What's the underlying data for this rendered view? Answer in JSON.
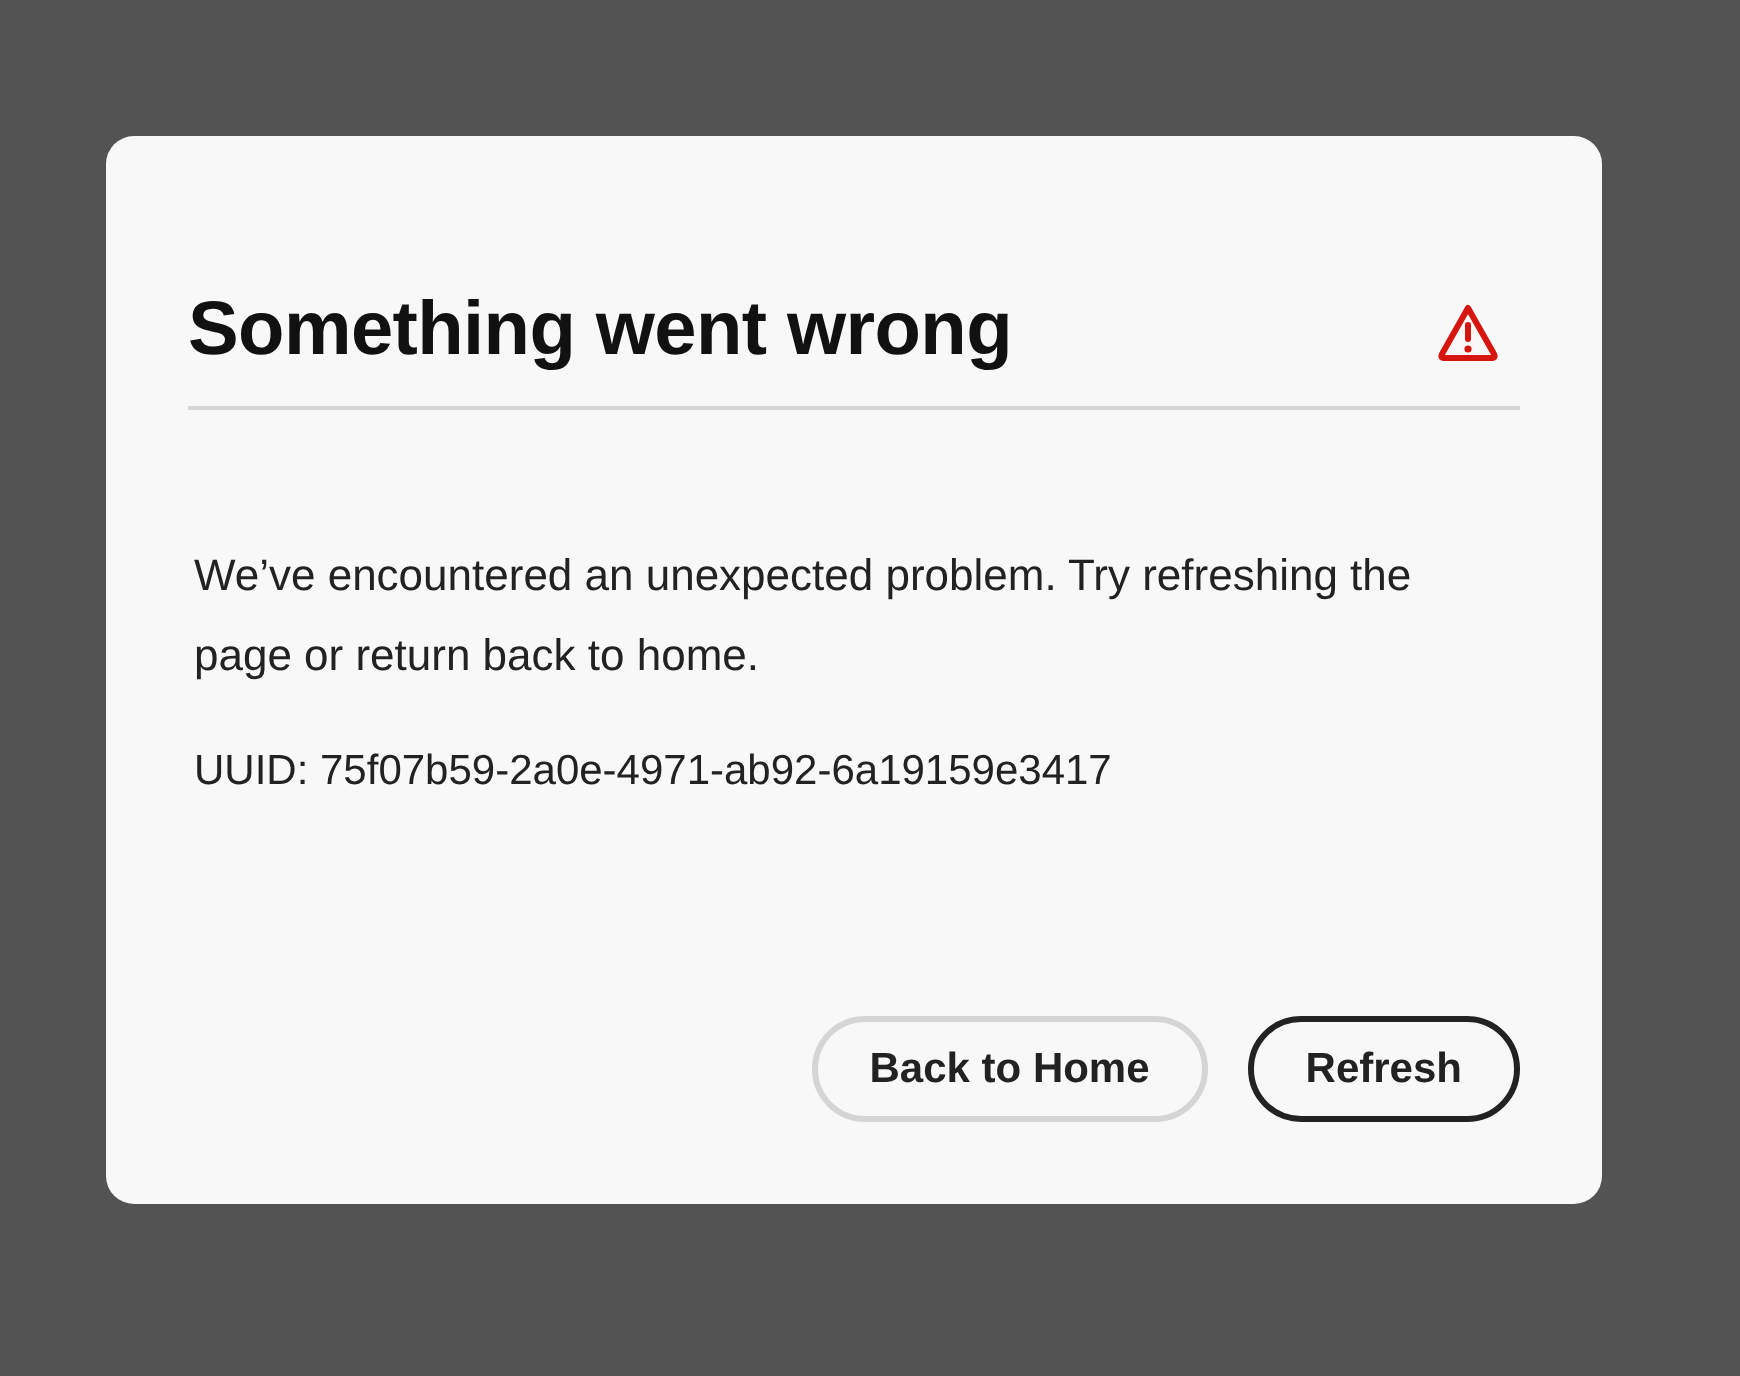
{
  "dialog": {
    "title": "Something went wrong",
    "message": "We’ve encountered an unexpected problem. Try refreshing the page or return back to home.",
    "uuid": "UUID: 75f07b59-2a0e-4971-ab92-6a19159e3417",
    "buttons": [
      {
        "label": "Back to Home",
        "kind": "secondary"
      },
      {
        "label": "Refresh",
        "kind": "primary"
      }
    ]
  }
}
